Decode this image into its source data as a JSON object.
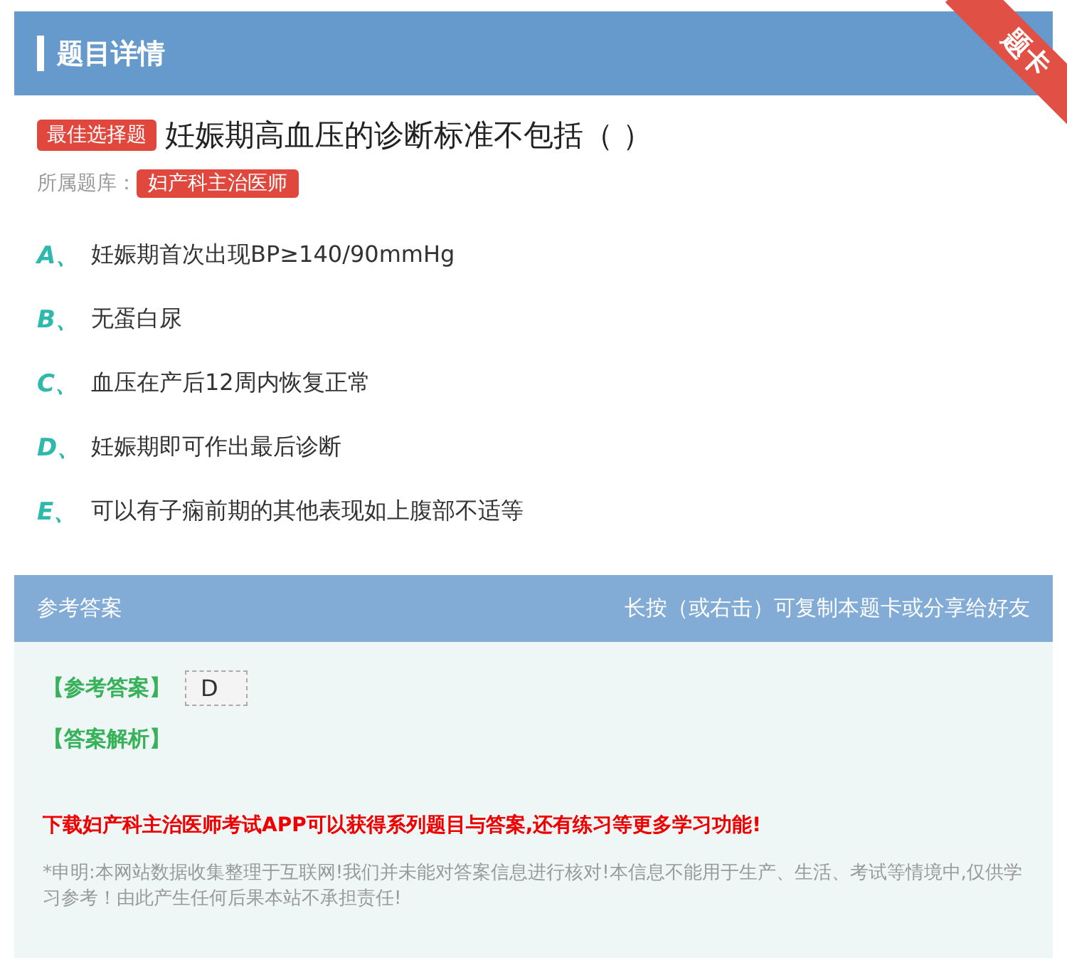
{
  "header": {
    "title": "题目详情",
    "ribbon": "题卡"
  },
  "question": {
    "type_badge": "最佳选择题",
    "text": "妊娠期高血压的诊断标准不包括（ ）",
    "bank_label": "所属题库：",
    "bank": "妇产科主治医师"
  },
  "options": [
    {
      "letter": "A、",
      "text": "妊娠期首次出现BP≥140/90mmHg"
    },
    {
      "letter": "B、",
      "text": "无蛋白尿"
    },
    {
      "letter": "C、",
      "text": "血压在产后12周内恢复正常"
    },
    {
      "letter": "D、",
      "text": "妊娠期即可作出最后诊断"
    },
    {
      "letter": "E、",
      "text": "可以有子痫前期的其他表现如上腹部不适等"
    }
  ],
  "answer_section": {
    "title": "参考答案",
    "hint": "长按（或右击）可复制本题卡或分享给好友",
    "answer_label": "【参考答案】",
    "answer": "D",
    "analysis_label": "【答案解析】",
    "promo": "下载妇产科主治医师考试APP可以获得系列题目与答案,还有练习等更多学习功能!",
    "disclaimer": "*申明:本网站数据收集整理于互联网!我们并未能对答案信息进行核对!本信息不能用于生产、生活、考试等情境中,仅供学习参考！由此产生任何后果本站不承担责任!"
  }
}
